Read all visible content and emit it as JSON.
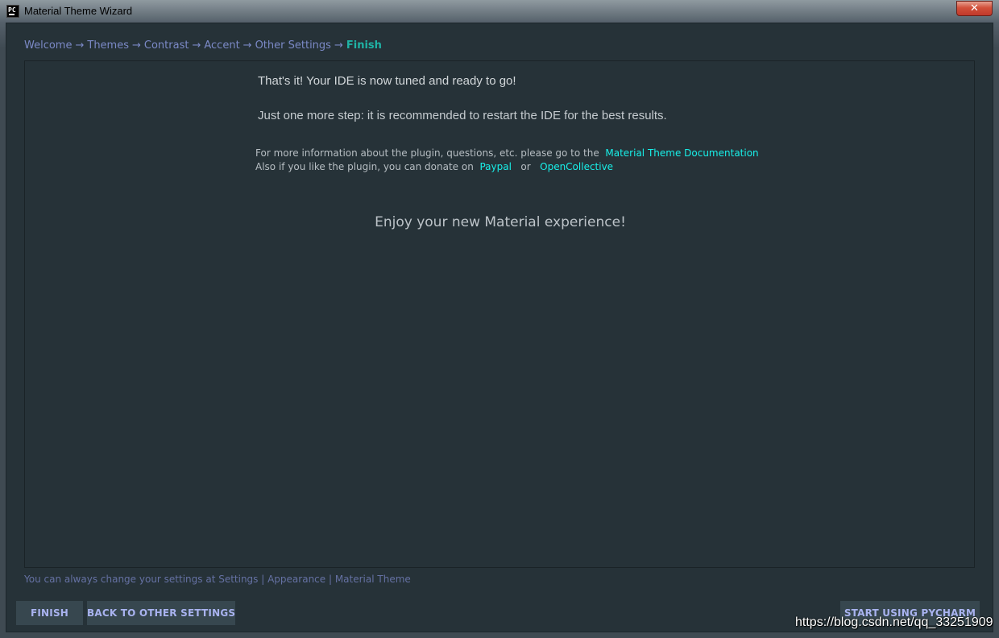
{
  "window": {
    "app_icon_text": "PC",
    "title": "Material Theme Wizard",
    "close_symbol": "✕"
  },
  "wizard": {
    "steps": [
      "Welcome",
      "Themes",
      "Contrast",
      "Accent",
      "Other Settings",
      "Finish"
    ],
    "arrow": "→",
    "current_step": "Finish"
  },
  "content": {
    "message_1": "That's it! Your IDE is now tuned and ready to go!",
    "message_2": "Just one more step: it is recommended to restart the IDE for the best results.",
    "info_prefix": "For more information about the plugin, questions, etc. please go to the",
    "doc_link": "Material Theme Documentation",
    "donate_prefix": "Also if you like the plugin, you can donate on",
    "paypal_link": "Paypal",
    "or_text": "or",
    "opencollective_link": "OpenCollective",
    "enjoy": "Enjoy your new Material experience!"
  },
  "footer": {
    "note": "You can always change your settings at Settings | Appearance | Material Theme",
    "finish_button": "FINISH",
    "back_button": "BACK TO OTHER SETTINGS",
    "start_button": "START USING PYCHARM"
  },
  "watermark": "https://blog.csdn.net/qq_33251909",
  "colors": {
    "background": "#263238",
    "accent": "#1fb3a5",
    "link": "#18f0e9",
    "button_bg": "#37474f",
    "button_text": "#a9b3f0"
  },
  "icons": {
    "close": "close-icon",
    "app": "pycharm-app-icon"
  }
}
